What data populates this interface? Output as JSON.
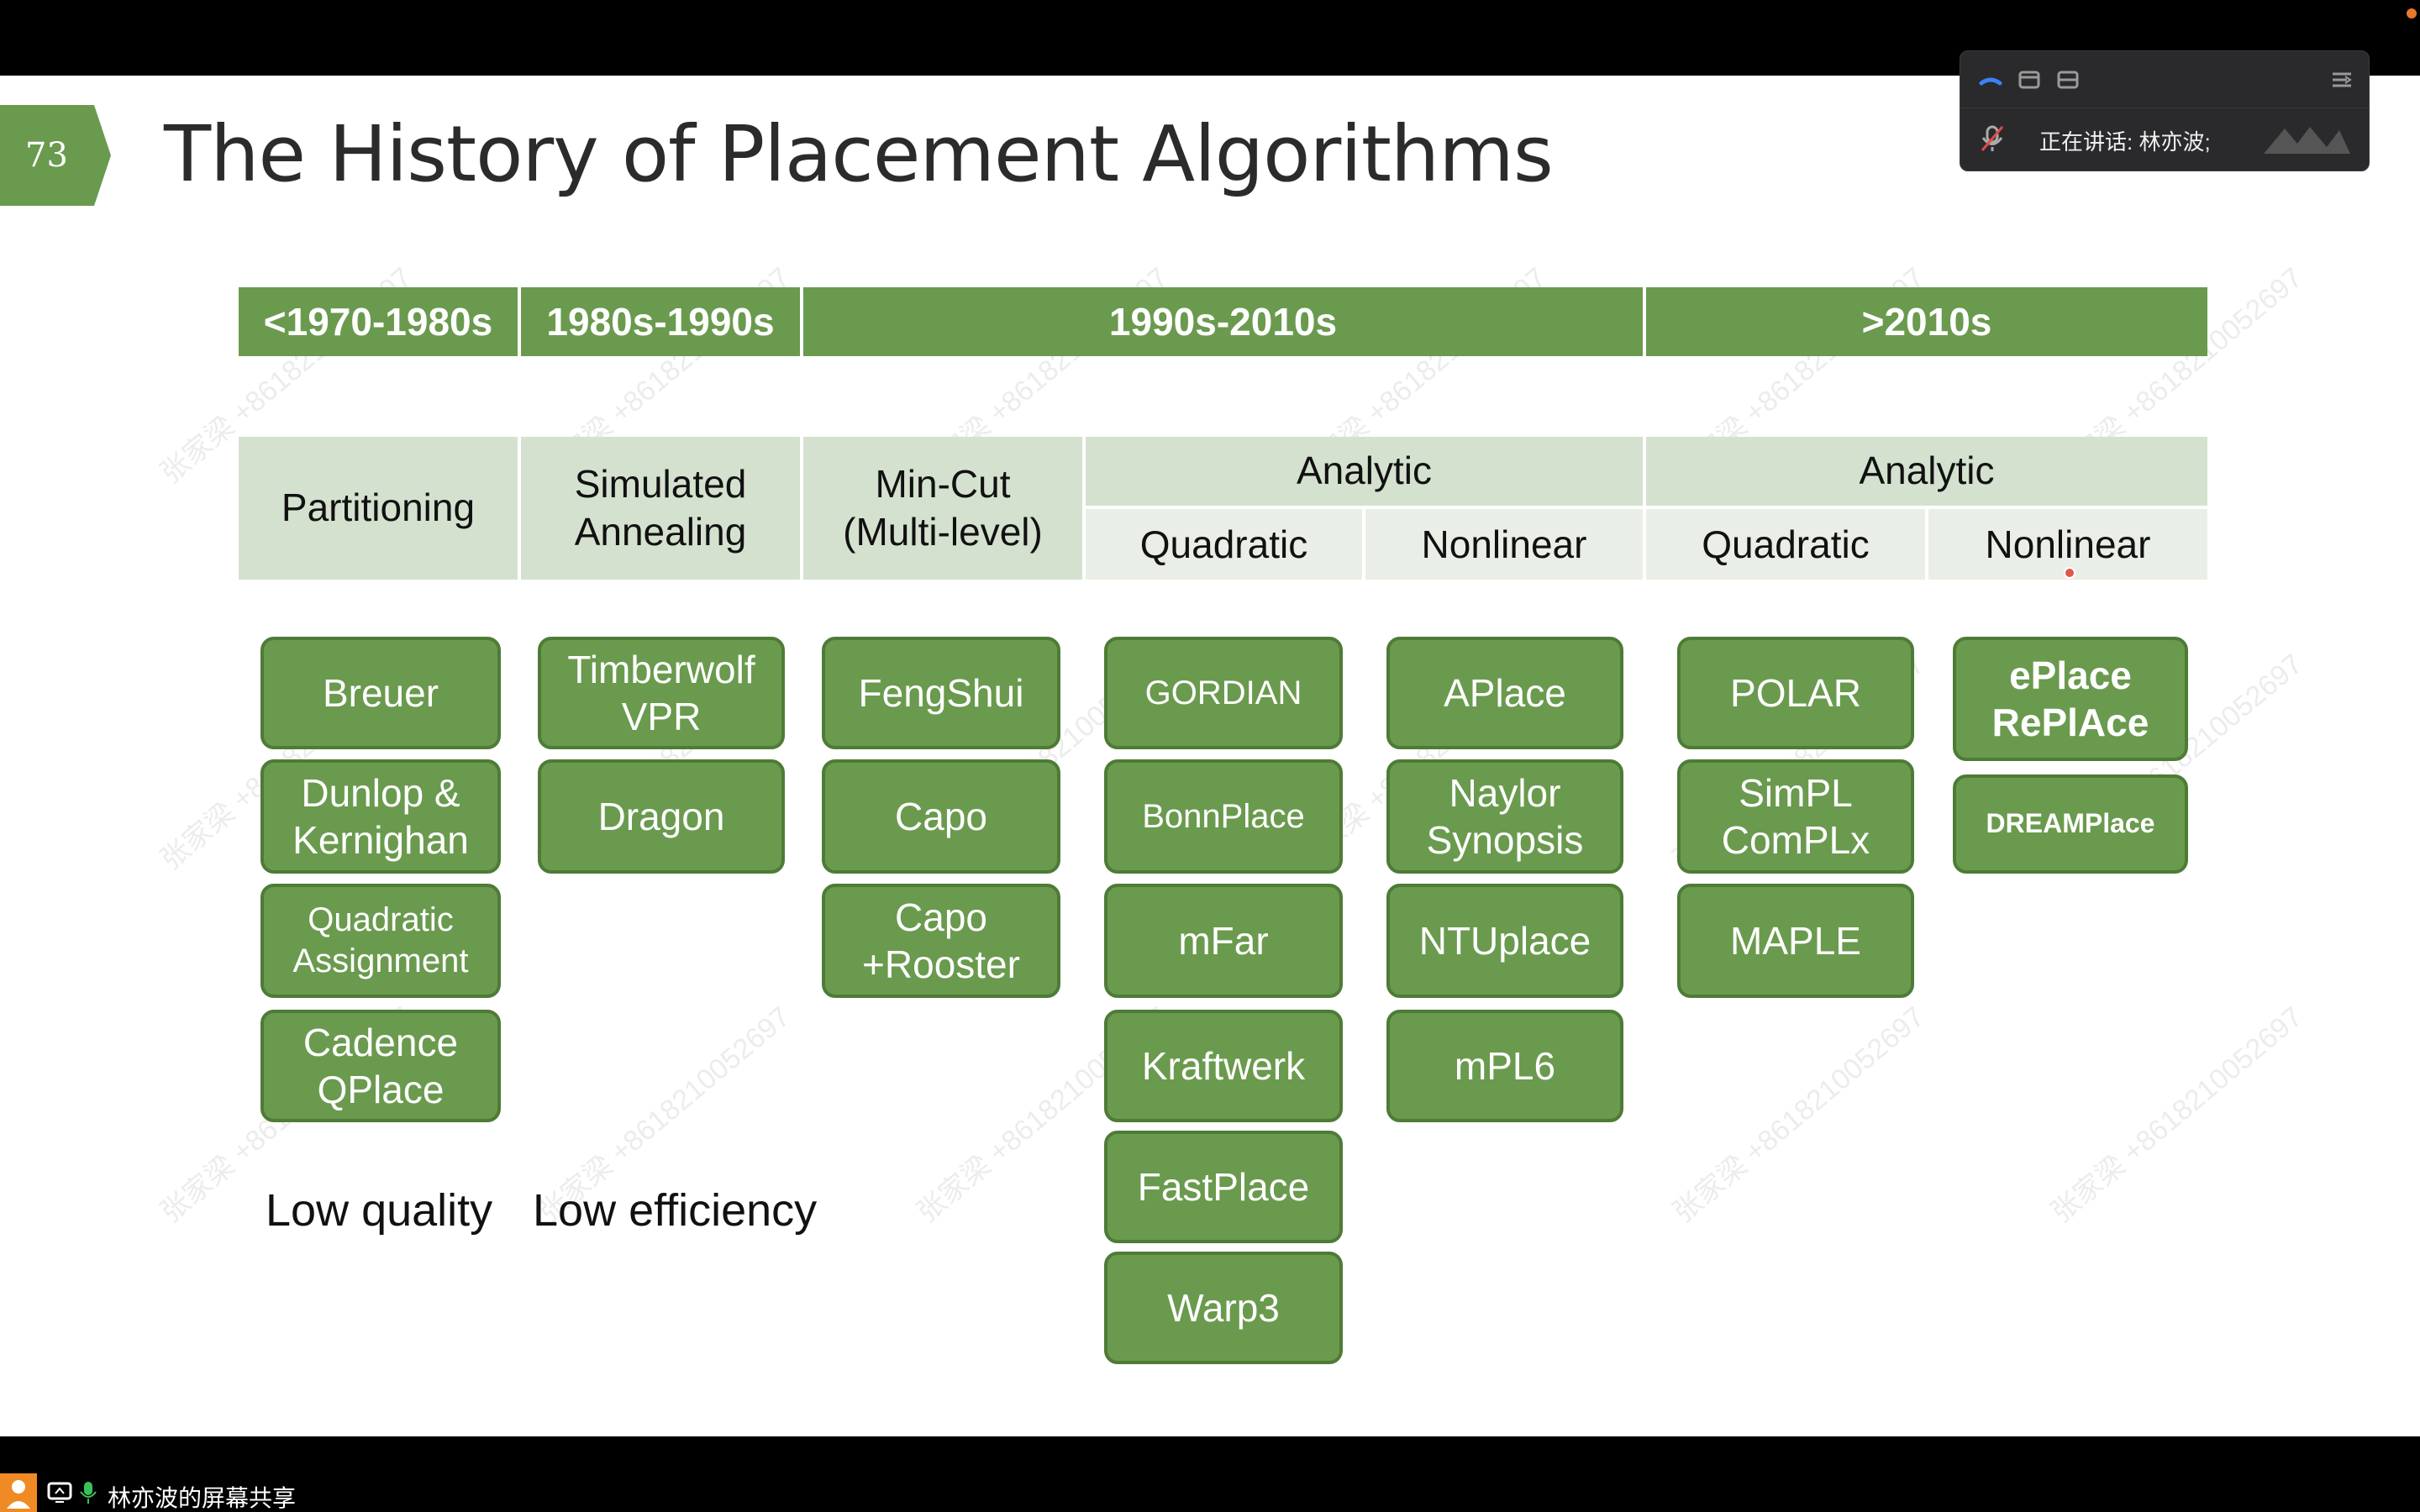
{
  "slide": {
    "page_number": "73",
    "title": "The History of Placement Algorithms"
  },
  "table": {
    "eras": [
      {
        "label": "<1970-1980s"
      },
      {
        "label": "1980s-1990s"
      },
      {
        "label": "1990s-2010s"
      },
      {
        "label": ">2010s"
      }
    ],
    "categories": {
      "partitioning": "Partitioning",
      "simulated_annealing": "Simulated\nAnnealing",
      "min_cut": "Min-Cut\n(Multi-level)",
      "analytic_1": "Analytic",
      "analytic_2": "Analytic",
      "quadratic_1": "Quadratic",
      "nonlinear_1": "Nonlinear",
      "quadratic_2": "Quadratic",
      "nonlinear_2": "Nonlinear"
    }
  },
  "algorithms": {
    "partitioning": [
      "Breuer",
      "Dunlop &\nKernighan",
      "Quadratic\nAssignment",
      "Cadence\nQPlace"
    ],
    "annealing": [
      "Timberwolf\nVPR",
      "Dragon"
    ],
    "mincut": [
      "FengShui",
      "Capo",
      "Capo\n+Rooster"
    ],
    "quadratic": [
      "GORDIAN",
      "BonnPlace",
      "mFar",
      "Kraftwerk",
      "FastPlace",
      "Warp3"
    ],
    "nonlinear": [
      "APlace",
      "Naylor\nSynopsis",
      "NTUplace",
      "mPL6"
    ],
    "quadratic_2010": [
      "POLAR",
      "SimPL\nComPLx",
      "MAPLE"
    ],
    "nonlinear_2010": [
      "ePlace\nRePlAce",
      "DREAMPlace"
    ]
  },
  "notes": {
    "low_quality": "Low quality",
    "low_efficiency": "Low efficiency"
  },
  "watermark": "张家梁 +8618210052697",
  "speaker_panel": {
    "speaking_text": "正在讲话: 林亦波;"
  },
  "share_bar": {
    "label": "林亦波的屏幕共享"
  },
  "colors": {
    "accent_green": "#6a9a4e",
    "header_light": "#d5e1cf",
    "header_lighter": "#e9efe6"
  }
}
